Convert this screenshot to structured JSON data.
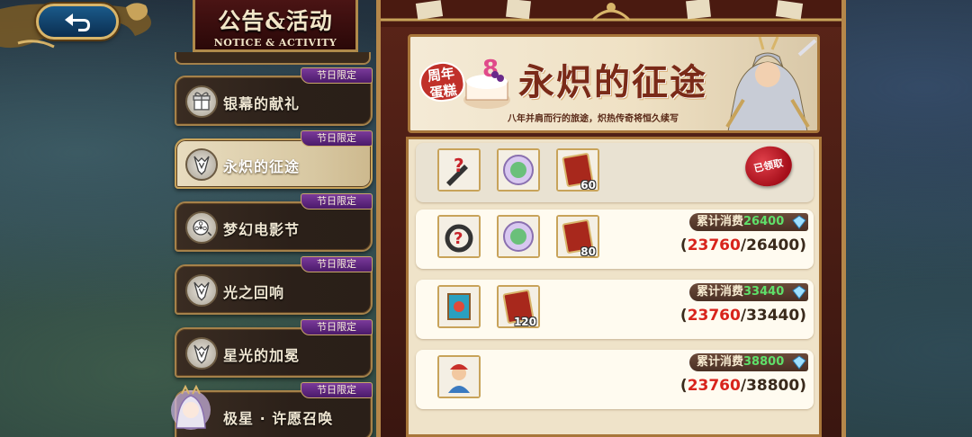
{
  "header": {
    "title_cn": "公告&活动",
    "title_en": "NOTICE & ACTIVITY"
  },
  "sidebar": {
    "items": [
      {
        "label": "银幕的献礼",
        "tag": "节日限定",
        "icon": "gift-icon",
        "active": false
      },
      {
        "label": "永炽的征途",
        "tag": "节日限定",
        "icon": "knight-helm-icon",
        "active": true
      },
      {
        "label": "梦幻电影节",
        "tag": "节日限定",
        "icon": "film-reel-icon",
        "active": false
      },
      {
        "label": "光之回响",
        "tag": "节日限定",
        "icon": "knight-helm-icon",
        "active": false
      },
      {
        "label": "星光的加冕",
        "tag": "节日限定",
        "icon": "knight-helm-icon",
        "active": false
      },
      {
        "label": "极星 · 许愿召唤",
        "tag": "节日限定",
        "icon": "character-avatar-icon",
        "active": false
      }
    ]
  },
  "banner": {
    "badge": "周年\n蛋糕",
    "title": "永炽的征途",
    "subtitle": "八年并肩而行的旅途，炽热传奇将恒久续写"
  },
  "rewards": [
    {
      "items": [
        {
          "icon": "mystery-sword-icon",
          "count": ""
        },
        {
          "icon": "green-medallion-icon",
          "count": ""
        },
        {
          "icon": "red-ticket-icon",
          "count": "60"
        }
      ],
      "claimed": true,
      "claimed_label": "已领取"
    },
    {
      "items": [
        {
          "icon": "mystery-ring-icon",
          "count": ""
        },
        {
          "icon": "green-medallion-icon",
          "count": ""
        },
        {
          "icon": "red-ticket-icon",
          "count": "80"
        }
      ],
      "cost_label": "累计消费",
      "cost_value": "26400",
      "current": "23760",
      "target": "26400"
    },
    {
      "items": [
        {
          "icon": "scroll-icon",
          "count": ""
        },
        {
          "icon": "red-ticket-icon",
          "count": "120"
        }
      ],
      "cost_label": "累计消费",
      "cost_value": "33440",
      "current": "23760",
      "target": "33440"
    },
    {
      "items": [
        {
          "icon": "character-card-icon",
          "count": ""
        }
      ],
      "cost_label": "累计消费",
      "cost_value": "38800",
      "current": "23760",
      "target": "38800"
    }
  ],
  "colors": {
    "accent_gold": "#c8a35a",
    "tag_purple": "#7a3a9a",
    "cost_green": "#5fe06a",
    "progress_red": "#d8241c"
  }
}
